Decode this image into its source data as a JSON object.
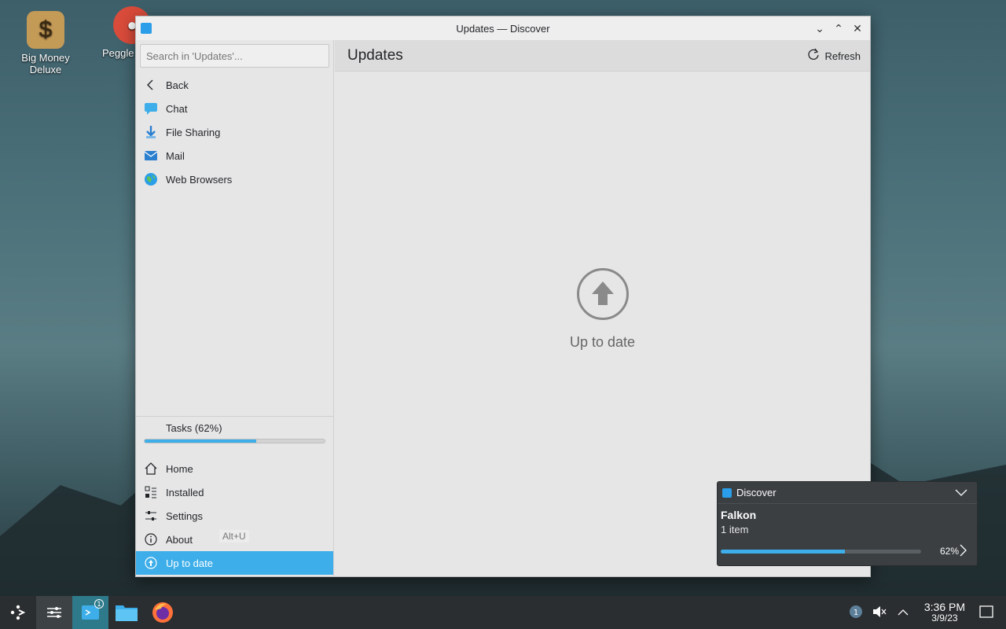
{
  "desktop": {
    "icons": [
      {
        "label": "Big Money Deluxe",
        "icon": "money-bag-icon"
      },
      {
        "label": "Peggle",
        "icon": "peggle-icon"
      }
    ]
  },
  "window": {
    "title": "Updates — Discover",
    "controls": [
      "minimize",
      "maximize",
      "close"
    ]
  },
  "sidebar": {
    "search_placeholder": "Search in 'Updates'...",
    "items": [
      {
        "label": "Back",
        "icon": "back-arrow-icon"
      },
      {
        "label": "Chat",
        "icon": "chat-icon"
      },
      {
        "label": "File Sharing",
        "icon": "file-sharing-icon"
      },
      {
        "label": "Mail",
        "icon": "mail-icon"
      },
      {
        "label": "Web Browsers",
        "icon": "globe-icon"
      }
    ],
    "tasks_label": "Tasks (62%)",
    "tasks_progress": 62,
    "bottom_items": [
      {
        "label": "Home",
        "icon": "home-icon"
      },
      {
        "label": "Installed",
        "icon": "installed-icon"
      },
      {
        "label": "Settings",
        "icon": "settings-icon"
      },
      {
        "label": "About",
        "icon": "info-icon"
      },
      {
        "label": "Up to date",
        "icon": "up-to-date-icon"
      }
    ],
    "shortcut_hint": "Alt+U"
  },
  "main": {
    "title": "Updates",
    "refresh_label": "Refresh",
    "status_label": "Up to date"
  },
  "notification": {
    "app": "Discover",
    "title": "Falkon",
    "subtitle": "1 item",
    "progress": 62,
    "percent_label": "62%"
  },
  "taskbar": {
    "discover_badge": "1",
    "tray_badge": "1",
    "time": "3:36 PM",
    "date": "3/9/23"
  },
  "colors": {
    "accent": "#3daee9",
    "notification_bg": "#3b3f42",
    "taskbar_bg": "#2b2e30"
  }
}
